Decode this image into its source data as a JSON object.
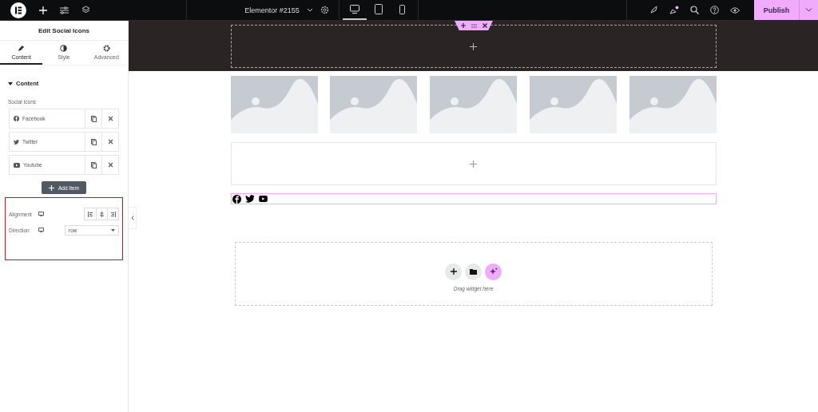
{
  "topbar": {
    "document": "Elementor #2155",
    "devices": [
      {
        "kind": "desktop",
        "selected": true
      },
      {
        "kind": "tablet",
        "selected": false
      },
      {
        "kind": "mobile",
        "selected": false
      }
    ],
    "publish": "Publish"
  },
  "panel": {
    "title": "Edit Social Icons",
    "tabs": [
      {
        "label": "Content",
        "kind": "pencil",
        "selected": true
      },
      {
        "label": "Style",
        "kind": "contrast",
        "selected": false
      },
      {
        "label": "Advanced",
        "kind": "gear",
        "selected": false
      }
    ],
    "section": {
      "title": "Content",
      "expanded": true
    },
    "repeater_label": "Social Icons",
    "items": [
      {
        "label": "Facebook",
        "kind": "facebook"
      },
      {
        "label": "Twitter",
        "kind": "twitter"
      },
      {
        "label": "Youtube",
        "kind": "youtube"
      }
    ],
    "add_item": "Add Item",
    "alignment": {
      "label": "Alignment"
    },
    "direction": {
      "label": "Direction",
      "value": "row"
    }
  },
  "canvas": {
    "social": [
      {
        "kind": "facebook"
      },
      {
        "kind": "twitter"
      },
      {
        "kind": "youtube"
      }
    ],
    "drop_hint": "Drag widget here"
  }
}
